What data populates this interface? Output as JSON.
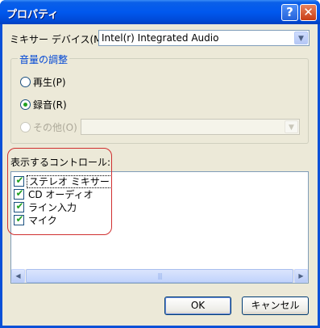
{
  "window": {
    "title": "プロパティ"
  },
  "titlebar": {
    "help_label": "?",
    "close_label": "✕"
  },
  "mixer": {
    "label": "ミキサー デバイス(M):",
    "value": "Intel(r) Integrated Audio"
  },
  "volume_group": {
    "title": "音量の調整",
    "options": [
      {
        "label": "再生(P)",
        "checked": false,
        "disabled": false
      },
      {
        "label": "録音(R)",
        "checked": true,
        "disabled": false
      },
      {
        "label": "その他(O)",
        "checked": false,
        "disabled": true
      }
    ],
    "other_value": ""
  },
  "controls": {
    "label": "表示するコントロール:",
    "items": [
      {
        "label": "ステレオ ミキサー",
        "checked": true,
        "focused": true
      },
      {
        "label": "CD オーディオ",
        "checked": true,
        "focused": false
      },
      {
        "label": "ライン入力",
        "checked": true,
        "focused": false
      },
      {
        "label": "マイク",
        "checked": true,
        "focused": false
      }
    ]
  },
  "buttons": {
    "ok": "OK",
    "cancel": "キャンセル"
  },
  "colors": {
    "titlebar": "#0058ee",
    "dialog_bg": "#ece9d8",
    "annotation": "#d03030",
    "check": "#21a121"
  }
}
